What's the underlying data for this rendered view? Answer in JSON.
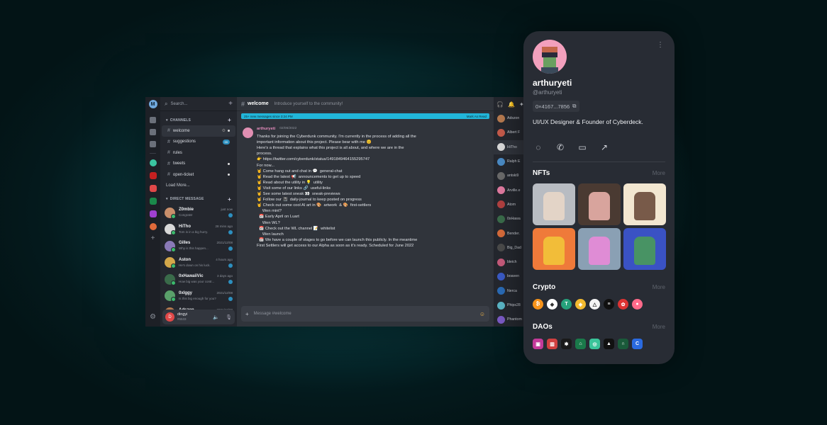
{
  "sidebar": {
    "search_placeholder": "Search...",
    "channels_title": "CHANNELS",
    "channels": [
      {
        "name": "welcome",
        "active": true
      },
      {
        "name": "suggestions",
        "badge": "99"
      },
      {
        "name": "rules"
      },
      {
        "name": "tweets"
      },
      {
        "name": "open-ticket"
      }
    ],
    "load_more": "Load More...",
    "dm_title": "DIRECT MESSAGE",
    "dms": [
      {
        "name": "Z0mbie",
        "time": "just now",
        "msg": "Congrats!",
        "color": "#c98f6b"
      },
      {
        "name": "HiTho",
        "time": "28 mins ago",
        "msg": "Tom is in a big hurry.",
        "color": "#d9d9d9"
      },
      {
        "name": "Gilles",
        "time": "2021/12/08",
        "msg": "Why is this happen...",
        "color": "#8a7ab8"
      },
      {
        "name": "Aston",
        "time": "4 hours ago",
        "msg": "He's down on his luck.",
        "color": "#d4a84a"
      },
      {
        "name": "0xHawaiiVic",
        "time": "3 days ago",
        "msg": "How big was your contr...",
        "color": "#3a6b4a"
      },
      {
        "name": "0xIggy",
        "time": "2021/12/08",
        "msg": "Is this big enough for you?",
        "color": "#5aa06a"
      },
      {
        "name": "Adszon",
        "time": "2021/12/08",
        "msg": "Yo Reddit! What's a small",
        "color": "#b5794f"
      }
    ],
    "me": {
      "name": "dingyi",
      "tag": "#6533",
      "initial": "D"
    }
  },
  "channel": {
    "name": "welcome",
    "description": "Introduce yourself to the community!",
    "new_messages": "25+ new messages since 3:24 PM",
    "mark_read": "Mark As Read",
    "composer_placeholder": "Message #welcome"
  },
  "message": {
    "author": "arthuryeti",
    "date": "02/06/2022",
    "lines": [
      "Thanks for joining the Cyberdunk community. I'm currently in the process of adding all the",
      "important information about this project. Please bear with me 😊",
      "",
      "Here's a thread that explains what this project is all about, and where we are in the",
      "process.",
      "👉 https://twitter.com/cyberdunk/status/1491849464155295747",
      "",
      "",
      "For now...",
      "",
      "🤘 Come hang out and chat in 💬  general-chat",
      "🤘 Read the latest 📢  announcements to get up to speed",
      "🤘 Read about the utility in 💡  utility",
      "🤘 Visit some of our links 🔗  useful-links",
      "🤘 See some latest sneak 👀  sneak-previews",
      "🤘 Follow our 📓  daily-journal to keep posted on progress",
      "🤘 Check out some cool AI art in 🎨  artwork  & 🎨  first-settlers",
      "",
      "",
      "     Wen mint?",
      "  📅 Early April on Luart",
      "",
      "",
      "     Wen WL?",
      "  📅 Check out the WL channel 📝  whitelist",
      "",
      "     Wen launch",
      "  📅 We have a couple of stages to go before we can launch this publicly. In the meantime",
      "First Settlers will get access to our Alpha as soon as it's ready. Scheduled for June 2022"
    ]
  },
  "members": [
    {
      "name": "Adszon",
      "color": "#b5794f"
    },
    {
      "name": "Albert F",
      "color": "#c45a4a"
    },
    {
      "name": "HiTho",
      "color": "#d9d9d9",
      "selected": true
    },
    {
      "name": "Ralph E",
      "color": "#4a8ac4"
    },
    {
      "name": "antski9",
      "color": "#6a6a6a"
    },
    {
      "name": "Arville.e",
      "color": "#e07aa0"
    },
    {
      "name": "Atom",
      "color": "#b04040"
    },
    {
      "name": "0xHawa",
      "color": "#3a6b4a"
    },
    {
      "name": "Bender.",
      "color": "#d46a3a"
    },
    {
      "name": "Big_Dad",
      "color": "#4a4a4a"
    },
    {
      "name": "bleich",
      "color": "#c45a7a"
    },
    {
      "name": "boaven",
      "color": "#3a5ac4"
    },
    {
      "name": "Nerca",
      "color": "#2a6ab4"
    },
    {
      "name": "Phips28",
      "color": "#5ab4c4"
    },
    {
      "name": "Phantom",
      "color": "#7a5ac4"
    }
  ],
  "profile": {
    "name": "arthuryeti",
    "handle": "@arthuryeti",
    "address": "0×4167...7856",
    "bio": "UI/UX Designer & Founder of Cyberdeck.",
    "nfts_title": "NFTs",
    "crypto_title": "Crypto",
    "daos_title": "DAOs",
    "more": "More",
    "nft_colors": [
      "#b8bcc2",
      "#4a3a32",
      "#f2e6d0",
      "#ef7a3a",
      "#8aa0b4",
      "#3a52c4"
    ],
    "crypto": [
      {
        "icon": "btc-icon",
        "color": "#f7931a",
        "glyph": "₿"
      },
      {
        "icon": "eth-icon",
        "color": "#ffffff",
        "glyph": "◆"
      },
      {
        "icon": "usdt-icon",
        "color": "#26a17b",
        "glyph": "T"
      },
      {
        "icon": "bnb-icon",
        "color": "#f3ba2f",
        "glyph": "◈"
      },
      {
        "icon": "ust-icon",
        "color": "#f4f4f4",
        "glyph": "△"
      },
      {
        "icon": "sol-icon",
        "color": "#101010",
        "glyph": "≡"
      },
      {
        "icon": "mushroom-icon",
        "color": "#d33",
        "glyph": "✿"
      },
      {
        "icon": "gradient-icon",
        "color": "#ff6a8a",
        "glyph": "●"
      }
    ],
    "daos": [
      {
        "icon": "dao-pink-icon",
        "color": "#c43a9a",
        "glyph": "▣"
      },
      {
        "icon": "dao-red-icon",
        "color": "#d04040",
        "glyph": "▥"
      },
      {
        "icon": "dao-star-icon",
        "color": "#1a1a1a",
        "glyph": "✱"
      },
      {
        "icon": "dao-green-icon",
        "color": "#1a7a4a",
        "glyph": "⌂"
      },
      {
        "icon": "dao-ring-icon",
        "color": "#3ac49a",
        "glyph": "◎"
      },
      {
        "icon": "dao-triangle-icon",
        "color": "#111111",
        "glyph": "▲"
      },
      {
        "icon": "dao-headset-icon",
        "color": "#1a5a3a",
        "glyph": "∩"
      },
      {
        "icon": "dao-c-icon",
        "color": "#2a6ae0",
        "glyph": "C"
      }
    ]
  }
}
